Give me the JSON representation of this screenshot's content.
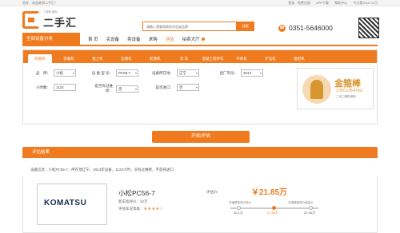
{
  "topbar": {
    "welcome": "您好，欢迎来到二手汇！",
    "links": [
      "登录 · 免费注册",
      "APP下载",
      "帮助中心"
    ],
    "date": "今天是2015·21日"
  },
  "header": {
    "logo_small": "工程机械网",
    "logo_big": "二手汇",
    "search_placeholder": "请输入想要搜索的车型或品牌",
    "search_button": "搜索",
    "phone": "0351-5646000"
  },
  "nav": {
    "category": "全部设备分类",
    "items": [
      "首 页",
      "买设备",
      "卖设备",
      "求购",
      "评估",
      "拍卖大厅"
    ]
  },
  "tabs": [
    "挖掘机",
    "装载机",
    "推土机",
    "压路机",
    "起重机",
    "泵 车",
    "混凝土搅拌车",
    "平地机",
    "铲运机",
    "凿岩机"
  ],
  "form": {
    "brand_label": "品　牌：",
    "brand": "小松",
    "model_label": "设 备 型 号：",
    "model": "PC56-7",
    "location_label": "设备所在地：",
    "location": "辽宁",
    "year_label": "出厂年份：",
    "year": "2013",
    "hours_label": "小时数：",
    "hours": "1122",
    "repair_label": "是否有过维修：",
    "repair": "否",
    "import_label": "是否进口：",
    "import": "否"
  },
  "ad": {
    "title": "金箍棒",
    "sub": "JINGUBANG",
    "sub2": "二手工程机械网"
  },
  "start_button": "开始评估",
  "result": {
    "heading": "评估结果",
    "description": "设备信息：小松PC56-7，所在地辽宁，2013年设备，1122小时，没有过维修，不是纯进口",
    "brand_logo": "KOMATSU",
    "model_name": "小松PC56-7",
    "new_price": "新车指导价：32万",
    "rating_label": "评估车况等级：",
    "stars": "★★★★☆",
    "price_label": "评估价：",
    "price": "￥21.85万",
    "range_low_label": "本编辑推荐价低价",
    "range_high_label": "本编辑推荐价格高价",
    "range": [
      "20.1万",
      "21.85万",
      "22.94万"
    ]
  }
}
